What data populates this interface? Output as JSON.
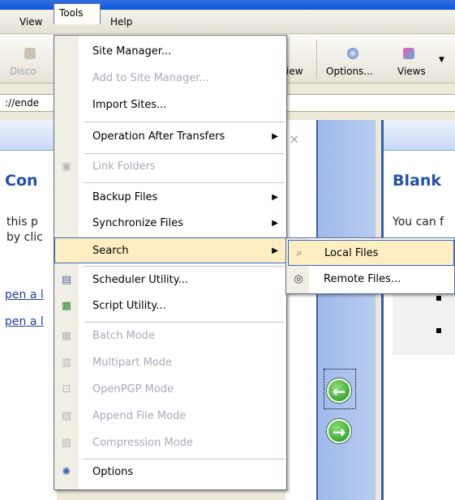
{
  "menubar": {
    "view": "View",
    "tools": "Tools",
    "help": "Help"
  },
  "toolbar": {
    "disconnect": "Disco",
    "view": "iew",
    "options": "Options...",
    "views": "Views"
  },
  "address": {
    "value": "://ende"
  },
  "left_pane": {
    "title": "Con",
    "line1": "this p",
    "line2": "by clic",
    "link1": "pen a l",
    "link2": "pen a l"
  },
  "right_pane": {
    "title": "Blank",
    "text": "You can f"
  },
  "mid_close": "×",
  "tools_menu": {
    "items": [
      {
        "label": "Site Manager...",
        "icon": "site-manager-icon",
        "disabled": false
      },
      {
        "label": "Add to Site Manager...",
        "icon": "",
        "disabled": true
      },
      {
        "label": "Import Sites...",
        "icon": "",
        "disabled": false
      },
      {
        "label": "Operation After Transfers",
        "icon": "",
        "disabled": false,
        "submenu": true
      },
      {
        "label": "Link Folders",
        "icon": "link-folders-icon",
        "disabled": true
      },
      {
        "label": "Backup Files",
        "icon": "",
        "disabled": false,
        "submenu": true
      },
      {
        "label": "Synchronize Files",
        "icon": "",
        "disabled": false,
        "submenu": true
      },
      {
        "label": "Search",
        "icon": "",
        "disabled": false,
        "submenu": true,
        "active": true
      },
      {
        "label": "Scheduler Utility...",
        "icon": "scheduler-icon",
        "disabled": false
      },
      {
        "label": "Script Utility...",
        "icon": "script-icon",
        "disabled": false
      },
      {
        "label": "Batch Mode",
        "icon": "batch-icon",
        "disabled": true
      },
      {
        "label": "Multipart Mode",
        "icon": "multipart-icon",
        "disabled": true
      },
      {
        "label": "OpenPGP Mode",
        "icon": "lock-icon",
        "disabled": true
      },
      {
        "label": "Append File Mode",
        "icon": "append-icon",
        "disabled": true
      },
      {
        "label": "Compression Mode",
        "icon": "compression-icon",
        "disabled": true
      },
      {
        "label": "Options",
        "icon": "options-icon",
        "disabled": false
      }
    ]
  },
  "search_submenu": {
    "local": "Local Files",
    "remote": "Remote Files..."
  },
  "colors": {
    "menu_highlight": "#ffeec2",
    "menu_border": "#316ac5",
    "panel_blue": "#b8ccf0",
    "title_blue": "#2450a8"
  }
}
